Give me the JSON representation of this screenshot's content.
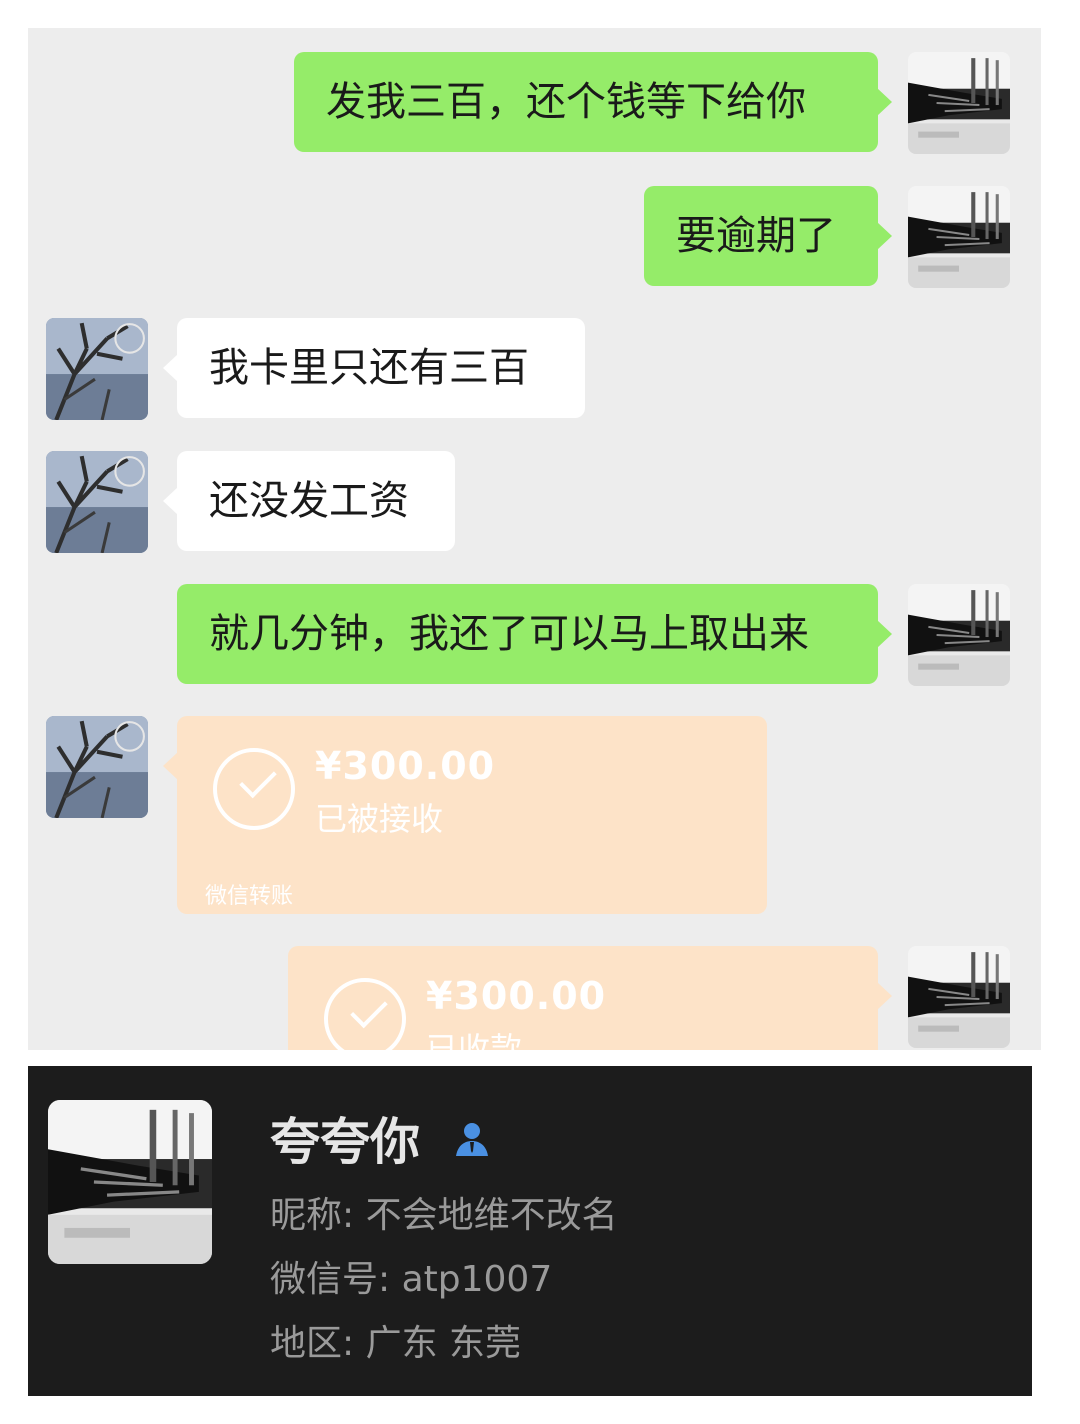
{
  "messages": [
    {
      "sender": "me",
      "text": "发我三百，还个钱等下给你"
    },
    {
      "sender": "me",
      "text": "要逾期了"
    },
    {
      "sender": "them",
      "text": "我卡里只还有三百"
    },
    {
      "sender": "them",
      "text": "还没发工资"
    },
    {
      "sender": "me",
      "text": "就几分钟，我还了可以马上取出来"
    }
  ],
  "transfers": [
    {
      "sender": "them",
      "amount": "¥300.00",
      "status": "已被接收",
      "label": "微信转账"
    },
    {
      "sender": "me",
      "amount": "¥300.00",
      "status": "已收款"
    }
  ],
  "profile": {
    "name": "夸夸你",
    "nickname": "昵称:  不会地维不改名",
    "wechat_id": "微信号:  atp1007",
    "region": "地区:  广东  东莞",
    "icon": "person-icon"
  },
  "colors": {
    "chat_bg": "#ededed",
    "my_bubble": "#95ec69",
    "their_bubble": "#ffffff",
    "transfer": "#fde3c8",
    "profile_bg": "#1c1c1c",
    "person_icon": "#4a90e2"
  }
}
